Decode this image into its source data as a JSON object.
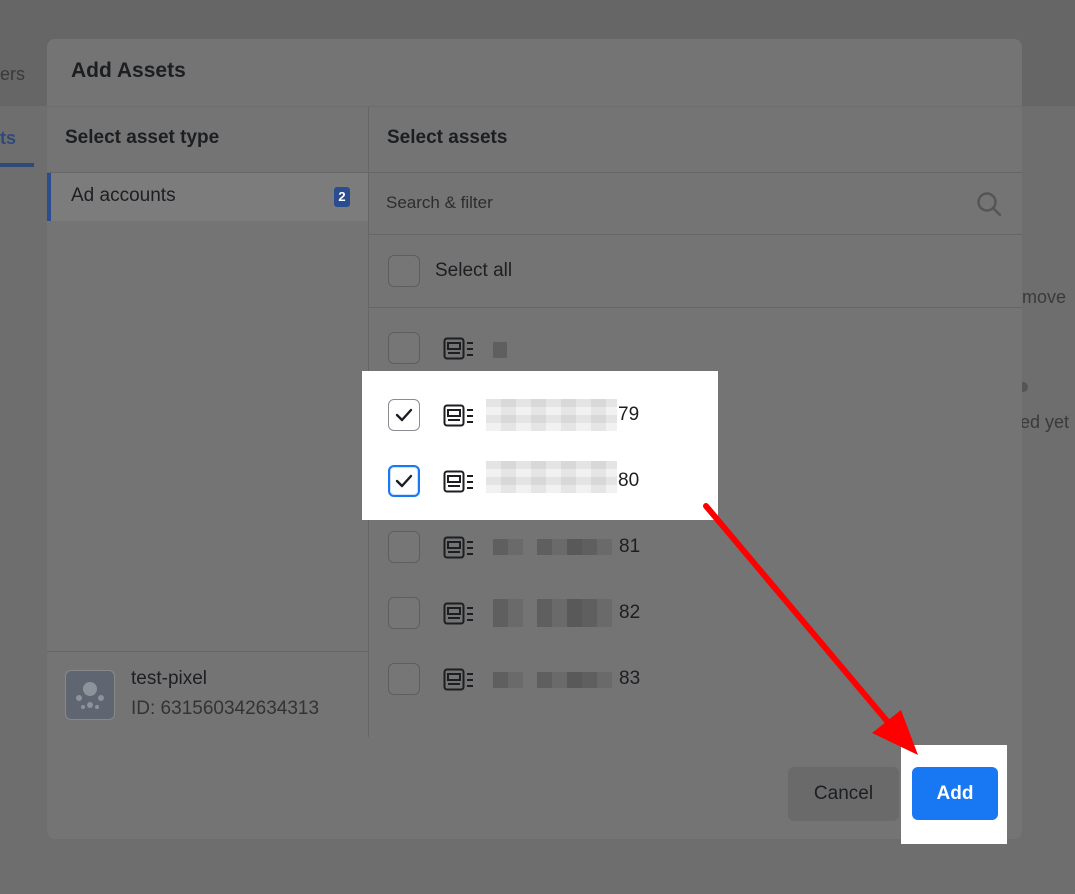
{
  "background": {
    "tab_partial_1": "ers",
    "tab_partial_2": "ts",
    "text_partial_1": "move",
    "text_partial_2": "ed yet"
  },
  "modal": {
    "title": "Add Assets",
    "left_heading": "Select asset type",
    "right_heading": "Select assets",
    "asset_types": [
      {
        "label": "Ad accounts",
        "badge": "2"
      }
    ],
    "pixel": {
      "name": "test-pixel",
      "id": "ID: 631560342634313"
    },
    "search": {
      "placeholder": "Search & filter"
    },
    "select_all_label": "Select all",
    "assets": [
      {
        "suffix": "",
        "checked": false
      },
      {
        "suffix": "79",
        "checked": true
      },
      {
        "suffix": "80",
        "checked": true
      },
      {
        "suffix": "81",
        "checked": false
      },
      {
        "suffix": "82",
        "checked": false
      },
      {
        "suffix": "83",
        "checked": false
      }
    ],
    "buttons": {
      "cancel": "Cancel",
      "add": "Add"
    }
  },
  "colors": {
    "primary": "#1877f2",
    "badge": "#2a4d8f",
    "annotation_arrow": "#ff0000"
  },
  "icons": [
    "search-icon",
    "ad-account-icon",
    "checkmark-icon",
    "pixel-icon",
    "arrow-annotation"
  ]
}
